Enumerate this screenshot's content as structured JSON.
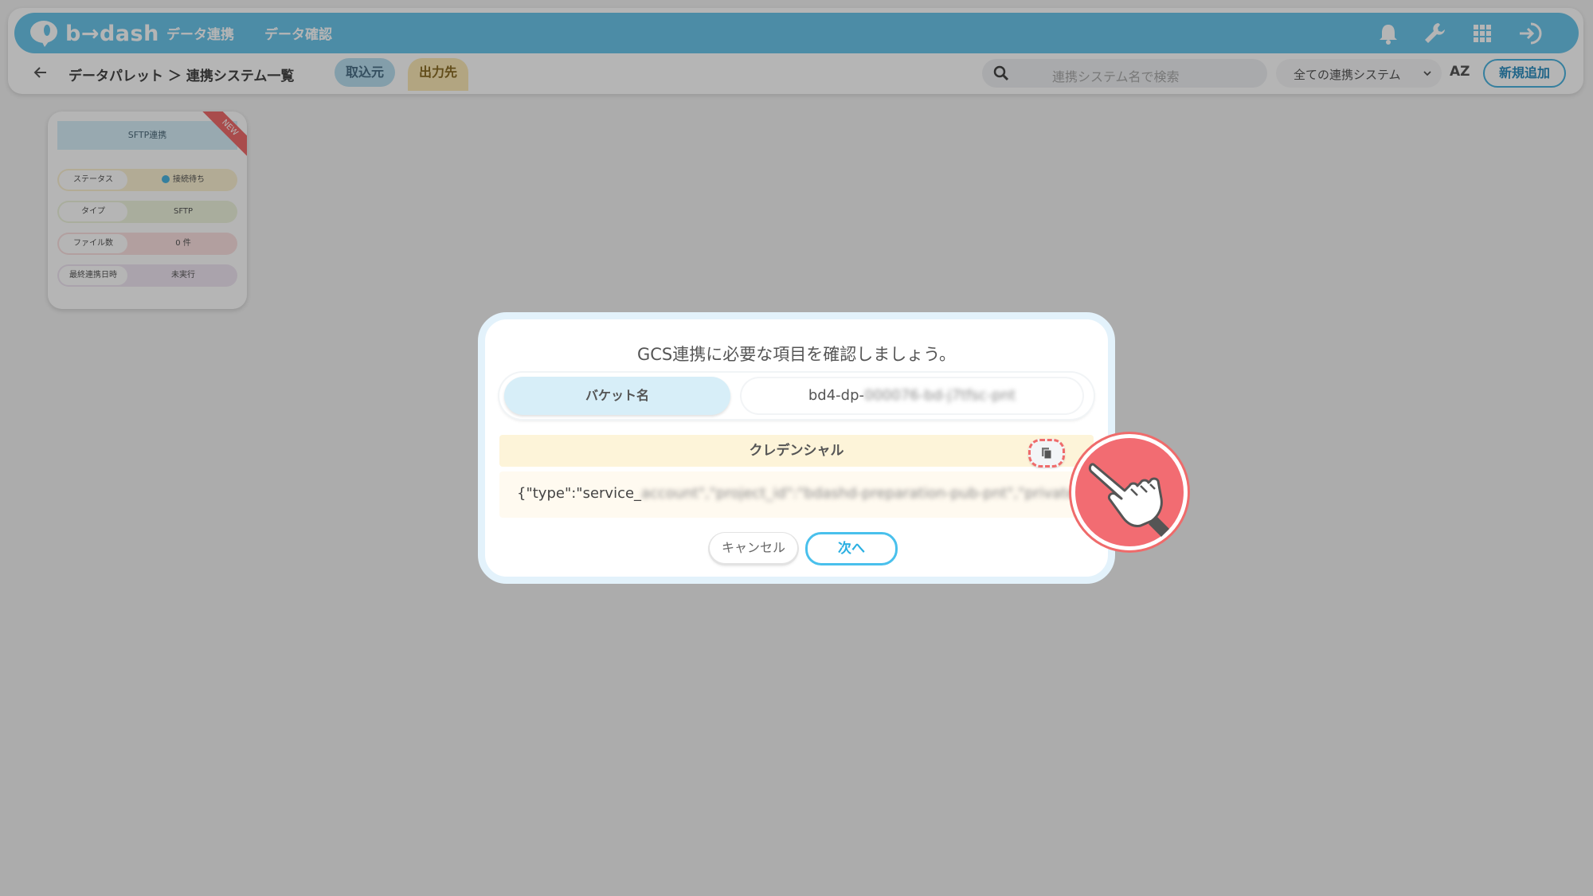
{
  "app": {
    "logo_text": "b→dash",
    "nav": [
      "データ連携",
      "データ確認"
    ],
    "icons": [
      "bell-icon",
      "wrench-icon",
      "grid-icon",
      "logout-icon"
    ]
  },
  "subbar": {
    "breadcrumb": "データパレット ＞ 連携システム一覧",
    "tab_in": "取込元",
    "tab_out": "出力先",
    "search_placeholder": "連携システム名で検索",
    "select_value": "全ての連携システム",
    "sort_label": "AZ",
    "add_button": "新規追加"
  },
  "card": {
    "title": "SFTP連携",
    "ribbon": "NEW",
    "rows": [
      {
        "label": "ステータス",
        "value": "接続待ち",
        "bg": "#fbf1d2"
      },
      {
        "label": "タイプ",
        "value": "SFTP",
        "bg": "#eef4dd"
      },
      {
        "label": "ファイル数",
        "value": "0 件",
        "bg": "#fbe1e1"
      },
      {
        "label": "最終連携日時",
        "value": "未実行",
        "bg": "#f0e6f3"
      }
    ]
  },
  "modal": {
    "title": "GCS連携に必要な項目を確認しましょう。",
    "bucket_label": "バケット名",
    "bucket_value_prefix": "bd4-dp-",
    "bucket_value_masked": "000076-bd-j7tfsc-pnt",
    "credential_header": "クレデンシャル",
    "credential_prefix": "{\"type\":\"service_",
    "credential_masked": "account\",\"project_id\":\"bdashd-preparation-pub-pnt\",\"private",
    "cancel_button": "キャンセル",
    "next_button": "次へ"
  },
  "colors": {
    "brand": "#6cc6ea",
    "accent_red": "#ef6b6b"
  }
}
